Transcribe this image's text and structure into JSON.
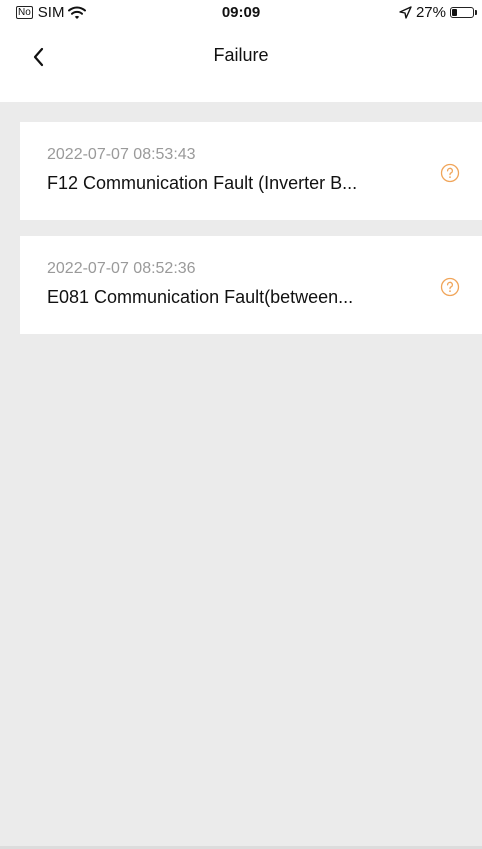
{
  "status_bar": {
    "carrier_badge": "No",
    "carrier": "SIM",
    "time": "09:09",
    "battery_percent": "27%",
    "battery_level": 0.27,
    "wifi_icon": "wifi-icon",
    "location_icon": "location-arrow-icon"
  },
  "nav": {
    "title": "Failure",
    "back_icon": "chevron-left-icon"
  },
  "failures": [
    {
      "time": "2022-07-07 08:53:43",
      "title": "F12 Communication Fault (Inverter B...",
      "icon": "help-circle-icon"
    },
    {
      "time": "2022-07-07 08:52:36",
      "title": "E081 Communication Fault(between...",
      "icon": "help-circle-icon"
    }
  ],
  "colors": {
    "background": "#ebebeb",
    "card": "#ffffff",
    "accent": "#f0a55a",
    "muted_text": "#9a9a9a"
  }
}
